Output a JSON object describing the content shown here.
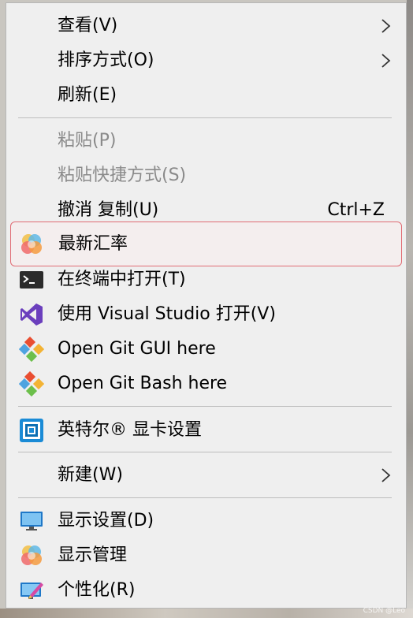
{
  "menu": {
    "items": [
      {
        "label": "查看(V)",
        "has_submenu": true
      },
      {
        "label": "排序方式(O)",
        "has_submenu": true
      },
      {
        "label": "刷新(E)"
      },
      {
        "label": "粘贴(P)",
        "disabled": true
      },
      {
        "label": "粘贴快捷方式(S)",
        "disabled": true
      },
      {
        "label": "撤消 复制(U)",
        "shortcut": "Ctrl+Z"
      },
      {
        "label": "最新汇率",
        "icon": "colorful-circles-icon",
        "highlighted": true
      },
      {
        "label": "在终端中打开(T)",
        "icon": "terminal-icon"
      },
      {
        "label": "使用 Visual Studio 打开(V)",
        "icon": "visual-studio-icon"
      },
      {
        "label": "Open Git GUI here",
        "icon": "git-icon"
      },
      {
        "label": "Open Git Bash here",
        "icon": "git-icon"
      },
      {
        "label": "英特尔® 显卡设置",
        "icon": "intel-graphics-icon"
      },
      {
        "label": "新建(W)",
        "has_submenu": true
      },
      {
        "label": "显示设置(D)",
        "icon": "display-settings-icon"
      },
      {
        "label": "显示管理",
        "icon": "colorful-circles-icon"
      },
      {
        "label": "个性化(R)",
        "icon": "personalize-icon"
      }
    ]
  },
  "colors": {
    "menu_background": "#efefef",
    "highlight_border": "#e06c74",
    "disabled_text": "#8a8a8a"
  },
  "watermark": "CSDN @Leo"
}
